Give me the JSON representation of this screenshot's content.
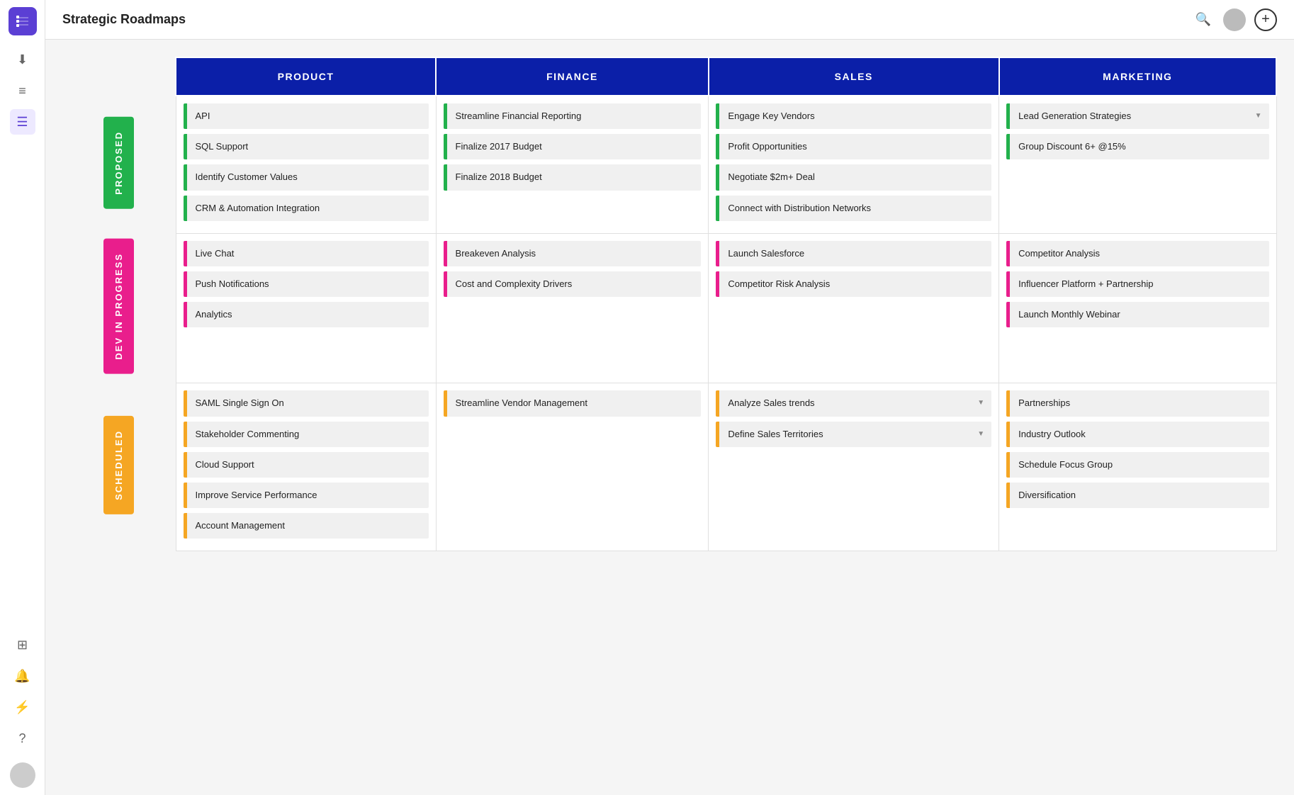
{
  "app": {
    "title": "Strategic Roadmaps"
  },
  "sidebar": {
    "items": [
      {
        "name": "download-icon",
        "symbol": "⬇",
        "active": false
      },
      {
        "name": "list-icon",
        "symbol": "≡",
        "active": false
      },
      {
        "name": "roadmap-icon",
        "symbol": "☰",
        "active": true
      },
      {
        "name": "user-add-icon",
        "symbol": "⊞",
        "active": false,
        "position": "bottom"
      },
      {
        "name": "bell-icon",
        "symbol": "🔔",
        "active": false,
        "position": "bottom"
      },
      {
        "name": "lightning-icon",
        "symbol": "⚡",
        "active": false,
        "position": "bottom"
      },
      {
        "name": "help-icon",
        "symbol": "?",
        "active": false,
        "position": "bottom"
      }
    ]
  },
  "columns": [
    {
      "id": "product",
      "label": "PRODUCT"
    },
    {
      "id": "finance",
      "label": "FINANCE"
    },
    {
      "id": "sales",
      "label": "SALES"
    },
    {
      "id": "marketing",
      "label": "MARKETING"
    }
  ],
  "rows": [
    {
      "id": "proposed",
      "label": "PROPOSED",
      "color": "green",
      "cells": {
        "product": [
          {
            "text": "API",
            "hasChevron": false
          },
          {
            "text": "SQL Support",
            "hasChevron": false
          },
          {
            "text": "Identify Customer Values",
            "hasChevron": false
          },
          {
            "text": "CRM & Automation Integration",
            "hasChevron": false
          }
        ],
        "finance": [
          {
            "text": "Streamline Financial Reporting",
            "hasChevron": false
          },
          {
            "text": "Finalize 2017 Budget",
            "hasChevron": false
          },
          {
            "text": "Finalize 2018 Budget",
            "hasChevron": false
          }
        ],
        "sales": [
          {
            "text": "Engage Key Vendors",
            "hasChevron": false
          },
          {
            "text": "Profit Opportunities",
            "hasChevron": false
          },
          {
            "text": "Negotiate $2m+ Deal",
            "hasChevron": false
          },
          {
            "text": "Connect with Distribution Networks",
            "hasChevron": false
          }
        ],
        "marketing": [
          {
            "text": "Lead Generation Strategies",
            "hasChevron": true
          },
          {
            "text": "Group Discount 6+ @15%",
            "hasChevron": false
          }
        ]
      }
    },
    {
      "id": "dev-in-progress",
      "label": "DEV IN PROGRESS",
      "color": "pink",
      "cells": {
        "product": [
          {
            "text": "Live Chat",
            "hasChevron": false
          },
          {
            "text": "Push Notifications",
            "hasChevron": false
          },
          {
            "text": "Analytics",
            "hasChevron": false
          }
        ],
        "finance": [
          {
            "text": "Breakeven Analysis",
            "hasChevron": false
          },
          {
            "text": "Cost and Complexity Drivers",
            "hasChevron": false
          }
        ],
        "sales": [
          {
            "text": "Launch Salesforce",
            "hasChevron": false
          },
          {
            "text": "Competitor Risk Analysis",
            "hasChevron": false
          }
        ],
        "marketing": [
          {
            "text": "Competitor Analysis",
            "hasChevron": false
          },
          {
            "text": "Influencer Platform + Partnership",
            "hasChevron": false
          },
          {
            "text": "Launch Monthly Webinar",
            "hasChevron": false
          }
        ]
      }
    },
    {
      "id": "scheduled",
      "label": "SCHEDULED",
      "color": "orange",
      "cells": {
        "product": [
          {
            "text": "SAML Single Sign On",
            "hasChevron": false
          },
          {
            "text": "Stakeholder Commenting",
            "hasChevron": false
          },
          {
            "text": "Cloud Support",
            "hasChevron": false
          },
          {
            "text": "Improve Service Performance",
            "hasChevron": false
          },
          {
            "text": "Account Management",
            "hasChevron": false
          }
        ],
        "finance": [
          {
            "text": "Streamline Vendor Management",
            "hasChevron": false
          }
        ],
        "sales": [
          {
            "text": "Analyze Sales trends",
            "hasChevron": true
          },
          {
            "text": "Define Sales Territories",
            "hasChevron": true
          }
        ],
        "marketing": [
          {
            "text": "Partnerships",
            "hasChevron": false
          },
          {
            "text": "Industry Outlook",
            "hasChevron": false
          },
          {
            "text": "Schedule Focus Group",
            "hasChevron": false
          },
          {
            "text": "Diversification",
            "hasChevron": false
          }
        ]
      }
    }
  ]
}
